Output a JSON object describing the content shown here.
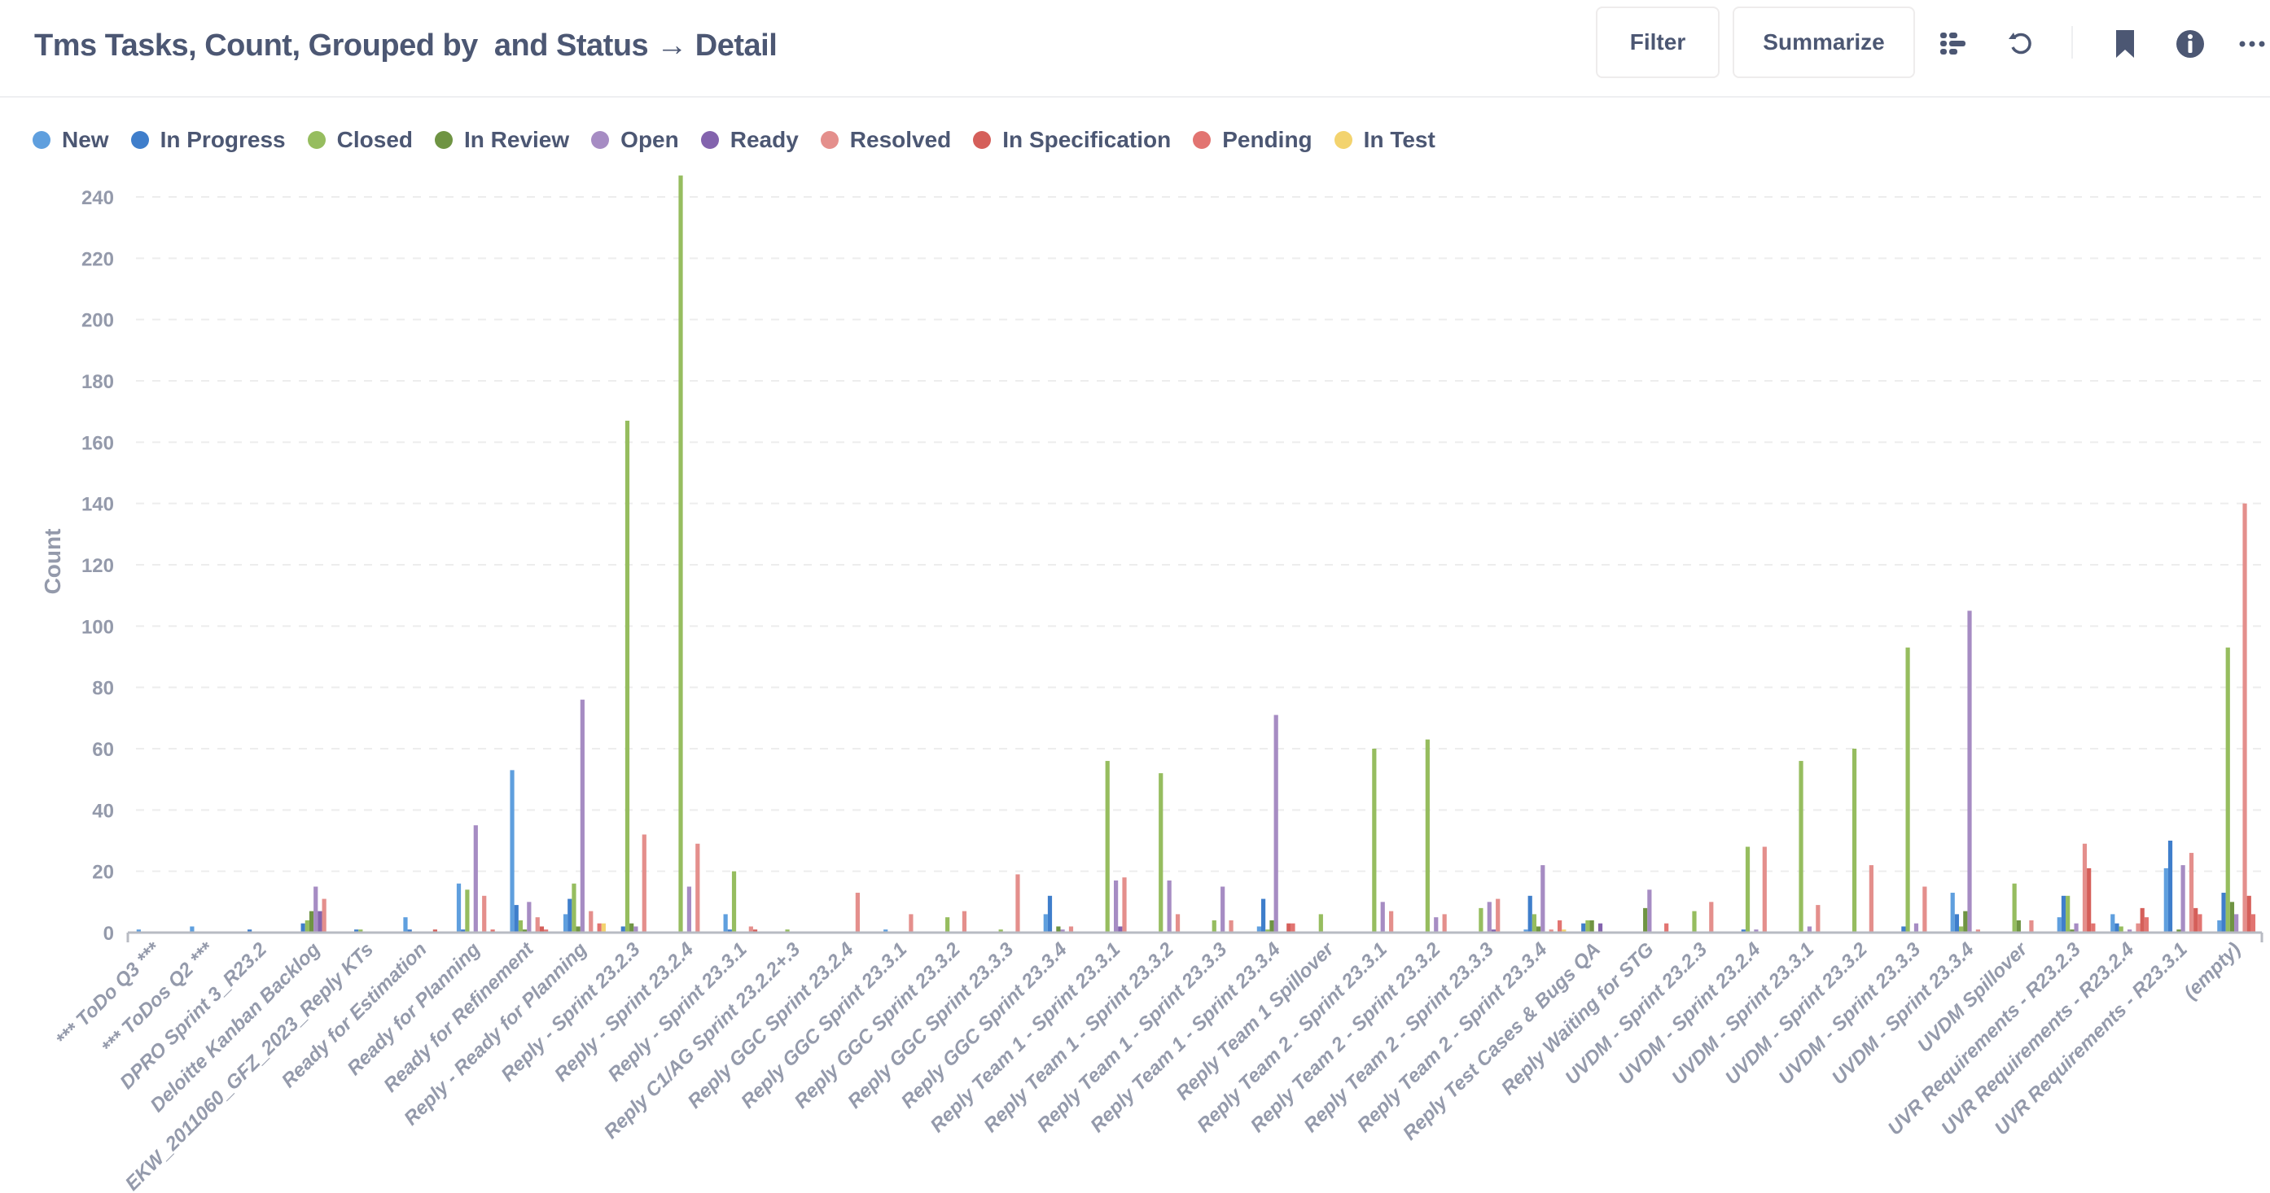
{
  "header": {
    "title": "Tms Tasks, Count, Grouped by  and Status → Detail",
    "filter_label": "Filter",
    "summarize_label": "Summarize",
    "icons": [
      "list-view-icon",
      "refresh-icon",
      "bookmark-icon",
      "info-icon",
      "more-icon"
    ]
  },
  "chart_data": {
    "type": "bar",
    "title": "Tms Tasks, Count, Grouped by  and Status",
    "xlabel": "",
    "ylabel": "Count",
    "ylim": [
      0,
      250
    ],
    "yticks": [
      0,
      20,
      40,
      60,
      80,
      100,
      120,
      140,
      160,
      180,
      200,
      220,
      240
    ],
    "grid": true,
    "legend_position": "top-left",
    "categories": [
      "*** ToDo Q3 ***",
      "*** ToDos Q2 ***",
      "DPRO Sprint 3_R23.2",
      "Deloitte Kanban Backlog",
      "EKW_2011060_GFZ_2023_Reply KTs",
      "Ready for Estimation",
      "Ready for Planning",
      "Ready for Refinement",
      "Reply - Ready for Planning",
      "Reply - Sprint 23.2.3",
      "Reply - Sprint 23.2.4",
      "Reply - Sprint 23.3.1",
      "Reply C1/AG Sprint 23.2.2+.3",
      "Reply GGC Sprint 23.2.4",
      "Reply GGC Sprint 23.3.1",
      "Reply GGC Sprint 23.3.2",
      "Reply GGC Sprint 23.3.3",
      "Reply GGC Sprint 23.3.4",
      "Reply Team 1 - Sprint 23.3.1",
      "Reply Team 1 - Sprint 23.3.2",
      "Reply Team 1 - Sprint 23.3.3",
      "Reply Team 1 - Sprint 23.3.4",
      "Reply Team 1 Spillover",
      "Reply Team 2 - Sprint 23.3.1",
      "Reply Team 2 - Sprint 23.3.2",
      "Reply Team 2 - Sprint 23.3.3",
      "Reply Team 2 - Sprint 23.3.4",
      "Reply Test Cases & Bugs QA",
      "Reply Waiting for STG",
      "UVDM - Sprint 23.2.3",
      "UVDM - Sprint 23.2.4",
      "UVDM - Sprint 23.3.1",
      "UVDM - Sprint 23.3.2",
      "UVDM - Sprint 23.3.3",
      "UVDM - Sprint 23.3.4",
      "UVDM Spillover",
      "UVR Requirements - R23.2.3",
      "UVR Requirements - R23.2.4",
      "UVR Requirements - R23.3.1",
      "(empty)"
    ],
    "series": [
      {
        "name": "New",
        "color": "#5f9fde",
        "values": [
          1,
          2,
          0,
          0,
          0,
          5,
          16,
          53,
          6,
          0,
          0,
          6,
          0,
          0,
          1,
          0,
          0,
          6,
          0,
          0,
          0,
          2,
          0,
          0,
          0,
          0,
          1,
          0,
          0,
          0,
          0,
          0,
          0,
          0,
          13,
          0,
          5,
          6,
          21,
          4
        ]
      },
      {
        "name": "In Progress",
        "color": "#3f7ecb",
        "values": [
          0,
          0,
          1,
          3,
          1,
          1,
          1,
          9,
          11,
          2,
          0,
          1,
          0,
          0,
          0,
          0,
          0,
          12,
          0,
          0,
          0,
          11,
          0,
          0,
          0,
          0,
          12,
          3,
          0,
          0,
          1,
          0,
          0,
          2,
          6,
          0,
          12,
          3,
          30,
          13
        ]
      },
      {
        "name": "Closed",
        "color": "#96bd5f",
        "values": [
          0,
          0,
          0,
          4,
          1,
          0,
          14,
          4,
          16,
          167,
          247,
          20,
          1,
          0,
          0,
          5,
          1,
          0,
          56,
          52,
          4,
          1,
          6,
          60,
          63,
          8,
          6,
          4,
          0,
          7,
          28,
          56,
          60,
          93,
          2,
          16,
          12,
          2,
          0,
          93
        ]
      },
      {
        "name": "In Review",
        "color": "#6f9443",
        "values": [
          0,
          0,
          0,
          7,
          0,
          0,
          0,
          1,
          2,
          3,
          0,
          0,
          0,
          0,
          0,
          0,
          0,
          2,
          0,
          0,
          0,
          4,
          0,
          0,
          0,
          0,
          2,
          4,
          8,
          0,
          0,
          0,
          0,
          0,
          7,
          4,
          1,
          0,
          1,
          10
        ]
      },
      {
        "name": "Open",
        "color": "#a68cc3",
        "values": [
          0,
          0,
          0,
          15,
          0,
          0,
          35,
          10,
          76,
          2,
          15,
          0,
          0,
          0,
          0,
          0,
          0,
          1,
          17,
          17,
          15,
          71,
          0,
          10,
          5,
          10,
          22,
          0,
          14,
          0,
          1,
          2,
          0,
          3,
          105,
          0,
          3,
          1,
          22,
          6
        ]
      },
      {
        "name": "Ready",
        "color": "#8363ad",
        "values": [
          0,
          0,
          0,
          7,
          0,
          0,
          0,
          0,
          0,
          0,
          0,
          0,
          0,
          0,
          0,
          0,
          0,
          0,
          2,
          0,
          0,
          0,
          0,
          0,
          0,
          1,
          0,
          3,
          0,
          0,
          0,
          0,
          0,
          0,
          0,
          0,
          0,
          0,
          0,
          0
        ]
      },
      {
        "name": "Resolved",
        "color": "#e48f8c",
        "values": [
          0,
          0,
          0,
          11,
          0,
          0,
          12,
          5,
          7,
          32,
          29,
          2,
          0,
          13,
          6,
          7,
          19,
          2,
          18,
          6,
          4,
          0,
          0,
          7,
          6,
          11,
          1,
          0,
          0,
          10,
          28,
          9,
          22,
          15,
          1,
          4,
          29,
          3,
          26,
          140
        ]
      },
      {
        "name": "In Specification",
        "color": "#d55f5a",
        "values": [
          0,
          0,
          0,
          0,
          0,
          1,
          0,
          2,
          0,
          0,
          0,
          1,
          0,
          0,
          0,
          0,
          0,
          0,
          0,
          0,
          0,
          3,
          0,
          0,
          0,
          0,
          0,
          0,
          0,
          0,
          0,
          0,
          0,
          0,
          0,
          0,
          21,
          8,
          8,
          12
        ]
      },
      {
        "name": "Pending",
        "color": "#e27471",
        "values": [
          0,
          0,
          0,
          0,
          0,
          0,
          1,
          1,
          3,
          0,
          0,
          0,
          0,
          0,
          0,
          0,
          0,
          0,
          0,
          0,
          0,
          3,
          0,
          0,
          0,
          0,
          4,
          0,
          3,
          0,
          0,
          0,
          0,
          0,
          0,
          0,
          3,
          5,
          6,
          6
        ]
      },
      {
        "name": "In Test",
        "color": "#f3d36e",
        "values": [
          0,
          0,
          0,
          0,
          0,
          0,
          0,
          0,
          3,
          0,
          0,
          0,
          0,
          0,
          0,
          0,
          0,
          0,
          0,
          0,
          0,
          0,
          0,
          0,
          0,
          0,
          1,
          0,
          0,
          0,
          0,
          0,
          0,
          0,
          0,
          0,
          0,
          0,
          0,
          0
        ]
      }
    ]
  }
}
